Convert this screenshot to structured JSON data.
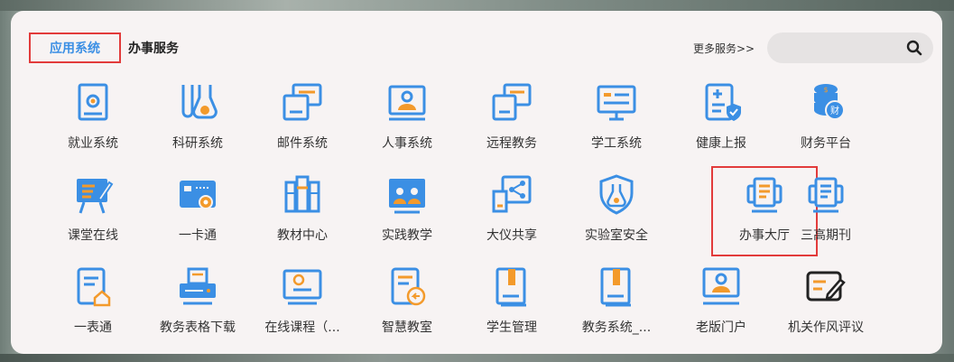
{
  "tabs": {
    "apps": "应用系统",
    "services": "办事服务"
  },
  "more_services": "更多服务>>",
  "search": {
    "value": "",
    "placeholder": ""
  },
  "accent": "#3b8fe4",
  "highlight_color": "#e23b3b",
  "items": [
    {
      "label": "就业系统",
      "icon": "employment-icon"
    },
    {
      "label": "科研系统",
      "icon": "flask-icon"
    },
    {
      "label": "邮件系统",
      "icon": "mail-icon"
    },
    {
      "label": "人事系统",
      "icon": "person-card-icon"
    },
    {
      "label": "远程教务",
      "icon": "remote-icon"
    },
    {
      "label": "学工系统",
      "icon": "monitor-icon"
    },
    {
      "label": "健康上报",
      "icon": "health-icon"
    },
    {
      "label": "财务平台",
      "icon": "coins-icon"
    },
    {
      "label": "课堂在线",
      "icon": "easel-icon"
    },
    {
      "label": "一卡通",
      "icon": "card-icon"
    },
    {
      "label": "教材中心",
      "icon": "books-icon"
    },
    {
      "label": "实践教学",
      "icon": "teaching-icon"
    },
    {
      "label": "大仪共享",
      "icon": "share-icon"
    },
    {
      "label": "实验室安全",
      "icon": "lab-shield-icon"
    },
    {
      "label": "办事大厅",
      "icon": "service-hall-icon"
    },
    {
      "label": "三高期刊",
      "icon": "journal-icon"
    },
    {
      "label": "一表通",
      "icon": "form-home-icon"
    },
    {
      "label": "教务表格下载",
      "icon": "printer-icon"
    },
    {
      "label": "在线课程（...",
      "icon": "online-course-icon"
    },
    {
      "label": "智慧教室",
      "icon": "smart-class-icon"
    },
    {
      "label": "学生管理",
      "icon": "book-icon"
    },
    {
      "label": "教务系统_...",
      "icon": "book2-icon"
    },
    {
      "label": "老版门户",
      "icon": "portal-icon"
    },
    {
      "label": "机关作风评议",
      "icon": "review-edit-icon"
    }
  ]
}
